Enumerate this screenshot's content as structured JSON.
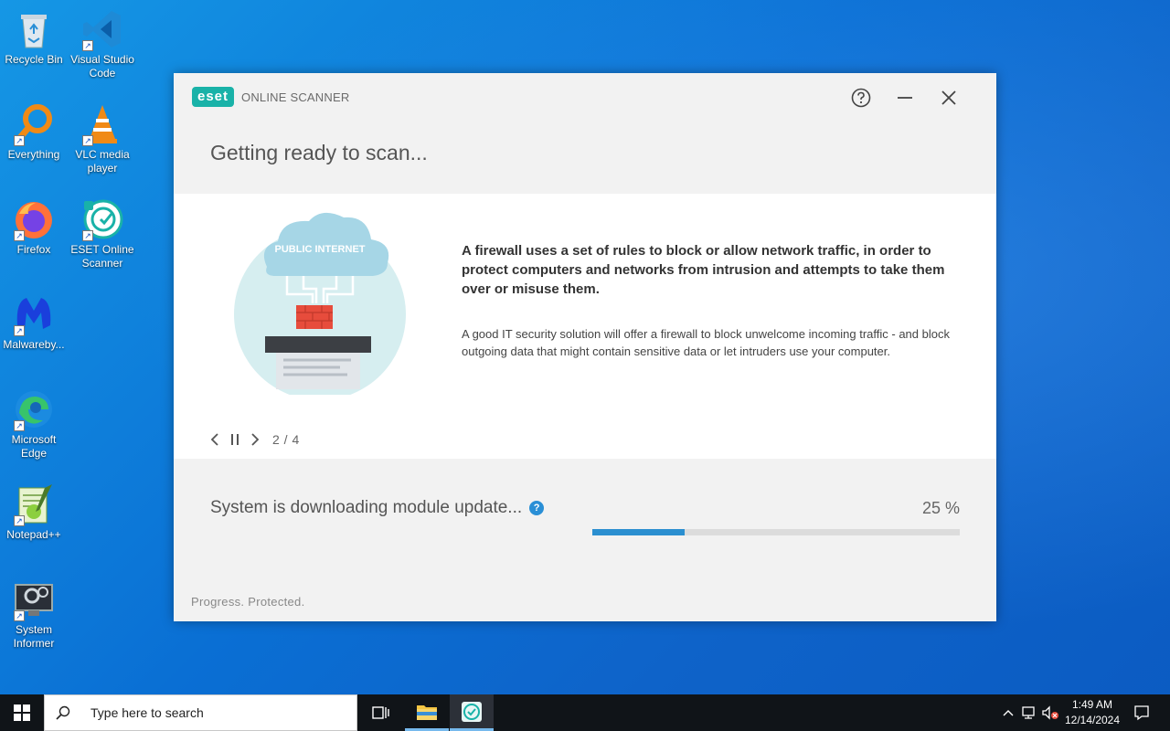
{
  "desktop": {
    "icons": [
      {
        "label": "Recycle Bin",
        "icon": "recycle-bin-icon"
      },
      {
        "label": "Visual Studio Code",
        "icon": "vscode-icon"
      },
      {
        "label": "Everything",
        "icon": "everything-search-icon"
      },
      {
        "label": "VLC media player",
        "icon": "vlc-icon"
      },
      {
        "label": "Firefox",
        "icon": "firefox-icon"
      },
      {
        "label": "ESET Online Scanner",
        "icon": "eset-scanner-icon"
      },
      {
        "label": "Malwareby...",
        "icon": "malwarebytes-icon"
      },
      {
        "label": "Microsoft Edge",
        "icon": "edge-icon"
      },
      {
        "label": "Notepad++",
        "icon": "notepadpp-icon"
      },
      {
        "label": "System Informer",
        "icon": "system-informer-icon"
      }
    ]
  },
  "eset": {
    "logo_mark": "eset",
    "logo_text": "ONLINE SCANNER",
    "title": "Getting ready to scan...",
    "illustration_text": "PUBLIC INTERNET",
    "tip_heading": "A firewall uses a set of rules to block or allow network traffic, in order to protect computers and networks from intrusion and attempts to take them over or misuse them.",
    "tip_body": "A good IT security solution will offer a firewall to block unwelcome incoming traffic - and block outgoing data that might contain sensitive data or let intruders use your computer.",
    "slide_counter": "2 / 4",
    "status_text": "System is downloading module update...",
    "status_help": "?",
    "percent_label": "25 %",
    "progress_fraction": 0.25,
    "tagline": "Progress. Protected.",
    "accent_color": "#19b2a8",
    "progress_color": "#2b8fd0"
  },
  "taskbar": {
    "search_placeholder": "Type here to search",
    "time": "1:49 AM",
    "date": "12/14/2024"
  }
}
